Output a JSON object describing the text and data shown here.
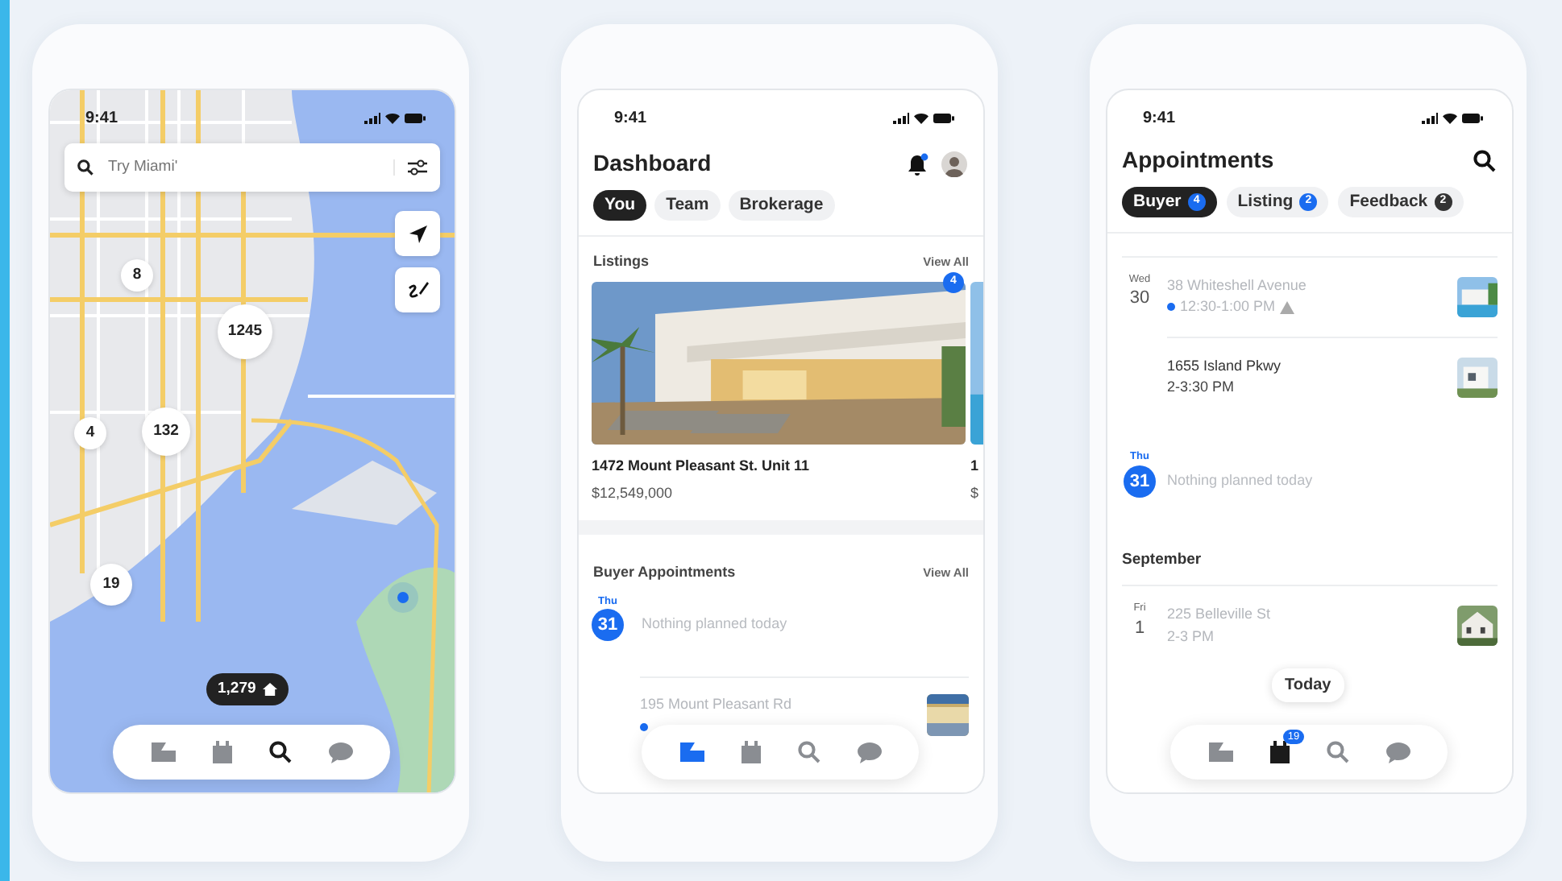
{
  "map_screen": {
    "status_time": "9:41",
    "search": {
      "placeholder": "Try Miami'"
    },
    "clusters": [
      {
        "label": "8"
      },
      {
        "label": "1245"
      },
      {
        "label": "132"
      },
      {
        "label": "4"
      },
      {
        "label": "19"
      }
    ],
    "results_count": "1,279",
    "nav": [
      {
        "kind": "home",
        "selected": false
      },
      {
        "kind": "calendar",
        "selected": false
      },
      {
        "kind": "search",
        "selected": true
      },
      {
        "kind": "chat",
        "selected": false
      }
    ]
  },
  "dashboard_screen": {
    "status_time": "9:41",
    "title": "Dashboard",
    "notification_dot": true,
    "tabs": [
      {
        "label": "You",
        "selected": true
      },
      {
        "label": "Team",
        "selected": false
      },
      {
        "label": "Brokerage",
        "selected": false
      }
    ],
    "listings": {
      "heading": "Listings",
      "view_all": "View All",
      "badge": "4",
      "cards": [
        {
          "title": "1472 Mount Pleasant St. Unit 11",
          "price": "$12,549,000"
        },
        {
          "title": "1",
          "price": "$"
        }
      ]
    },
    "appointments": {
      "heading": "Buyer Appointments",
      "view_all": "View All",
      "weekday": "Thu",
      "day": "31",
      "today": true,
      "empty_text": "Nothing planned today",
      "items": [
        {
          "address": "195 Mount Pleasant Rd",
          "past": true,
          "dot": true
        }
      ]
    },
    "nav": [
      {
        "kind": "home",
        "selected": true
      },
      {
        "kind": "calendar",
        "selected": false
      },
      {
        "kind": "search",
        "selected": false
      },
      {
        "kind": "chat",
        "selected": false
      }
    ]
  },
  "appointments_screen": {
    "status_time": "9:41",
    "title": "Appointments",
    "tabs": [
      {
        "label": "Buyer",
        "count": "4",
        "color": "#1a6cf0",
        "selected": true
      },
      {
        "label": "Listing",
        "count": "2",
        "color": "#1a6cf0",
        "selected": false
      },
      {
        "label": "Feedback",
        "count": "2",
        "color": "#333333",
        "selected": false
      }
    ],
    "groups": [
      {
        "kind": "day",
        "weekday": "Wed",
        "day": "30",
        "today": false,
        "entries": [
          {
            "kind": "appointment",
            "address": "38 Whiteshell Avenue",
            "time": "12:30-1:00 PM",
            "past": true,
            "dot": true,
            "warning": true
          },
          {
            "kind": "appointment",
            "address": "1655 Island Pkwy",
            "time": "2-3:30 PM",
            "past": false,
            "dot": false,
            "warning": false
          }
        ]
      },
      {
        "kind": "day",
        "weekday": "Thu",
        "day": "31",
        "today": true,
        "entries": [
          {
            "kind": "empty",
            "text": "Nothing planned today"
          }
        ]
      },
      {
        "kind": "month",
        "label": "September"
      },
      {
        "kind": "day",
        "weekday": "Fri",
        "day": "1",
        "today": false,
        "entries": [
          {
            "kind": "appointment",
            "address": "225 Belleville St",
            "time": "2-3 PM",
            "past": true,
            "dot": false,
            "warning": false
          }
        ]
      }
    ],
    "today_button": "Today",
    "nav": [
      {
        "kind": "home",
        "selected": false
      },
      {
        "kind": "calendar",
        "selected": true,
        "badge": "19"
      },
      {
        "kind": "search",
        "selected": false
      },
      {
        "kind": "chat",
        "selected": false
      }
    ]
  }
}
